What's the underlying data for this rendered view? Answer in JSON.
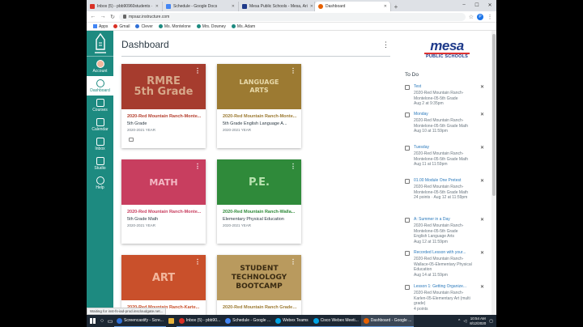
{
  "browser": {
    "tabs": [
      {
        "label": "Inbox (5) - pbb90960students ·",
        "color": "#d93025"
      },
      {
        "label": "Schedule - Google Docs",
        "color": "#4285f4"
      },
      {
        "label": "Mesa Public Schools - Mesa, Ari",
        "color": "#1e3a8a"
      },
      {
        "label": "Dashboard",
        "color": "#e66000"
      }
    ],
    "new_tab": "+",
    "url": "mpsaz.instructure.com",
    "profile_initial": "P",
    "bookmarks": [
      {
        "label": "Apps",
        "color": "#4285f4"
      },
      {
        "label": "Gmail",
        "color": "#d93025"
      },
      {
        "label": "Clever",
        "color": "#2f6fd6"
      },
      {
        "label": "Ms. Montelone",
        "color": "#1d8a80"
      },
      {
        "label": "Mrs. Downey",
        "color": "#1d8a80"
      },
      {
        "label": "Ms. Adam",
        "color": "#1d8a80"
      }
    ]
  },
  "global_nav": {
    "items": [
      {
        "label": "Account",
        "icon": "account-icon"
      },
      {
        "label": "Dashboard",
        "icon": "dashboard-icon",
        "active": true
      },
      {
        "label": "Courses",
        "icon": "courses-icon"
      },
      {
        "label": "Calendar",
        "icon": "calendar-icon"
      },
      {
        "label": "Inbox",
        "icon": "inbox-icon"
      },
      {
        "label": "Studio",
        "icon": "studio-icon"
      },
      {
        "label": "Help",
        "icon": "help-icon"
      }
    ]
  },
  "dashboard": {
    "title": "Dashboard",
    "cards": [
      {
        "art": "RMRE\n5th Grade",
        "bg": "#a63c2e",
        "fg": "#d7a88a",
        "title": "2020-Red Mountain Ranch-Monte...",
        "title_color": "#b5402f",
        "subtitle": "5th Grade",
        "term": "2020-2021 YEAR"
      },
      {
        "art": "LANGUAGE\nARTS",
        "bg": "#9c7a32",
        "fg": "#e8d9a9",
        "title": "2020-Red Mountain Ranch-Monte...",
        "title_color": "#9c7a32",
        "subtitle": "5th Grade English Language A...",
        "term": "2020-2021 YEAR"
      },
      {
        "art": "MATH",
        "bg": "#c83e5f",
        "fg": "#f4b9c5",
        "title": "2020-Red Mountain Ranch-Monte...",
        "title_color": "#c83e5f",
        "subtitle": "5th Grade Math",
        "term": "2020-2021 YEAR"
      },
      {
        "art": "P.E.",
        "bg": "#2f8a3a",
        "fg": "#b9e3b0",
        "title": "2020-Red Mountain Ranch-Walla...",
        "title_color": "#2f8a3a",
        "subtitle": "Elementary Physical Education",
        "term": "2020-2021 YEAR"
      },
      {
        "art": "ART",
        "bg": "#c9502b",
        "fg": "#f2b79d",
        "title": "2020-Red Mountain Ranch-Karte...",
        "title_color": "#c9502b",
        "subtitle": "",
        "term": ""
      },
      {
        "art": "STUDENT\nTECHNOLOGY\nBOOTCAMP",
        "bg": "#b99a5e",
        "fg": "#3a2b12",
        "title": "2020-Red Mountain Ranch Grade ...",
        "title_color": "#9c7a32",
        "subtitle": "",
        "term": ""
      }
    ]
  },
  "sidebar": {
    "logo_text": "mesa",
    "logo_sub": "PUBLIC SCHOOLS",
    "todo_heading": "To Do",
    "todos": [
      {
        "title": "Test",
        "course": "2020-Red Mountain Ranch-Montelone-05-5th Grade",
        "due": "Aug 2 at 9:35pm"
      },
      {
        "title": "Monday",
        "course": "2020-Red Mountain Ranch-Montelone-05-5th Grade Math",
        "due": "Aug 10 at 11:59pm"
      },
      {
        "title": "Tuesday",
        "course": "2020-Red Mountain Ranch-Montelone-05-5th Grade Math",
        "due": "Aug 11 at 11:59pm"
      },
      {
        "title": "01.00 Module One Pretest",
        "course": "2020-Red Mountain Ranch-Montelone-05-5th Grade Math",
        "due": "24 points · Aug 12 at 11:59pm"
      },
      {
        "title": "A: Summer in a Day",
        "course": "2020-Red Mountain Ranch-Montelone-05-5th Grade English Language Arts",
        "due": "Aug 12 at 11:59pm"
      },
      {
        "title": "Recorded Lesson with your...",
        "course": "2020-Red Mountain Ranch-Wallace-05-Elementary Physical Education",
        "due": "Aug 14 at 11:59pm"
      },
      {
        "title": "Lesson 1: Getting Organize...",
        "course": "2020-Red Mountain Ranch-Karlen-05-Elementary Art (multi grade)",
        "due": "4 points"
      }
    ]
  },
  "status_text": "Waiting for inst-fs-iad-prod.inscloudgate.net...",
  "taskbar": {
    "apps": [
      {
        "label": "Screencastify - Scre...",
        "color": "#2f6fd6"
      },
      {
        "label": "Inbox (5) - pbb90...",
        "color": "#d93025"
      },
      {
        "label": "Schedule - Google ...",
        "color": "#4285f4"
      },
      {
        "label": "Webex Teams",
        "color": "#00a4e4"
      },
      {
        "label": "Cisco Webex Meeti...",
        "color": "#00a4e4"
      },
      {
        "label": "Dashboard - Google ...",
        "color": "#e66000",
        "active": true
      }
    ],
    "time": "10:54 AM",
    "date": "8/12/2020"
  }
}
